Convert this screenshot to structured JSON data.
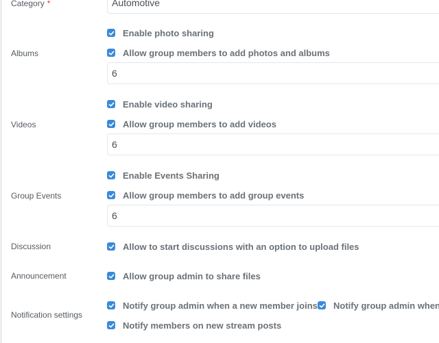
{
  "category": {
    "label": "Category",
    "required_mark": "*",
    "value": "Automotive"
  },
  "albums": {
    "label": "Albums",
    "opt1": "Enable photo sharing",
    "opt2": "Allow group members to add photos and albums",
    "count": "6"
  },
  "videos": {
    "label": "Videos",
    "opt1": "Enable video sharing",
    "opt2": "Allow group members to add videos",
    "count": "6"
  },
  "events": {
    "label": "Group Events",
    "opt1": "Enable Events Sharing",
    "opt2": "Allow group members to add group events",
    "count": "6"
  },
  "discussion": {
    "label": "Discussion",
    "opt1": "Allow to start discussions with an option to upload files"
  },
  "announcement": {
    "label": "Announcement",
    "opt1": "Allow group admin to share files"
  },
  "notifications": {
    "label": "Notification settings",
    "opt1": "Notify group admin when a new member joins",
    "opt2": "Notify group admin when",
    "opt3": "Notify members on new stream posts"
  },
  "colors": {
    "checkbox": "#3b8ad9"
  },
  "icons": {
    "checkbox": "check-icon"
  }
}
